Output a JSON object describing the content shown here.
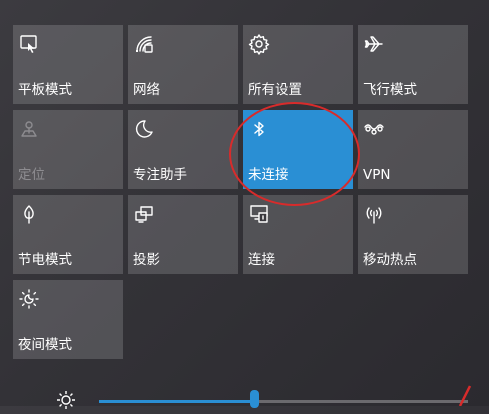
{
  "tiles": [
    {
      "label": "平板模式",
      "icon": "tablet-mode-icon"
    },
    {
      "label": "网络",
      "icon": "network-icon"
    },
    {
      "label": "所有设置",
      "icon": "gear-icon"
    },
    {
      "label": "飞行模式",
      "icon": "airplane-icon"
    },
    {
      "label": "定位",
      "icon": "location-icon"
    },
    {
      "label": "专注助手",
      "icon": "moon-icon"
    },
    {
      "label": "未连接",
      "icon": "bluetooth-icon"
    },
    {
      "label": "VPN",
      "icon": "vpn-icon"
    },
    {
      "label": "节电模式",
      "icon": "battery-saver-icon"
    },
    {
      "label": "投影",
      "icon": "project-icon"
    },
    {
      "label": "连接",
      "icon": "connect-icon"
    },
    {
      "label": "移动热点",
      "icon": "mobile-hotspot-icon"
    },
    {
      "label": "夜间模式",
      "icon": "night-light-icon"
    }
  ],
  "brightness": {
    "level_percent": 42,
    "icon": "sun-icon"
  },
  "colors": {
    "accent": "#2a8fd4",
    "annotation": "#d82b2b",
    "tile_bg": "rgba(255,255,255,0.16)"
  }
}
